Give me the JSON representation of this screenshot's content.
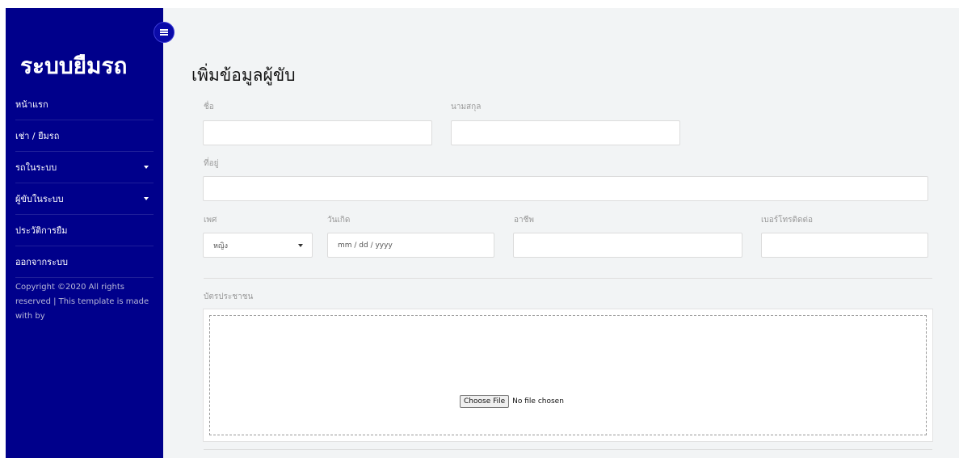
{
  "sidebar": {
    "brand": "ระบบยืมรถ",
    "toggle_icon": "menu-icon",
    "items": [
      {
        "label": "หน้าแรก",
        "caret": false
      },
      {
        "label": "เช่า / ยืมรถ",
        "caret": false
      },
      {
        "label": "รถในระบบ",
        "caret": true
      },
      {
        "label": "ผู้ขับในระบบ",
        "caret": true
      },
      {
        "label": "ประวัติการยืม",
        "caret": false
      },
      {
        "label": "ออกจากระบบ",
        "caret": false
      }
    ],
    "copyright": "Copyright ©2020 All rights reserved | This template is made with by"
  },
  "form": {
    "title": "เพิ่มข้อมูลผู้ขับ",
    "first_name_label": "ชื่อ",
    "first_name_value": "",
    "last_name_label": "นามสกุล",
    "last_name_value": "",
    "address_label": "ที่อยู่",
    "address_value": "",
    "gender_label": "เพศ",
    "gender_value": "หญิง",
    "birthdate_label": "วันเกิด",
    "birthdate_placeholder": "mm / dd / yyyy",
    "occupation_label": "อาชีพ",
    "occupation_value": "",
    "phone_label": "เบอร์โทรติดต่อ",
    "phone_value": "",
    "id_card_label": "บัตรประชาชน",
    "file_button": "Choose File",
    "file_status": "No file chosen"
  },
  "colors": {
    "sidebar": "#00008b",
    "background": "#f2f4f5"
  }
}
